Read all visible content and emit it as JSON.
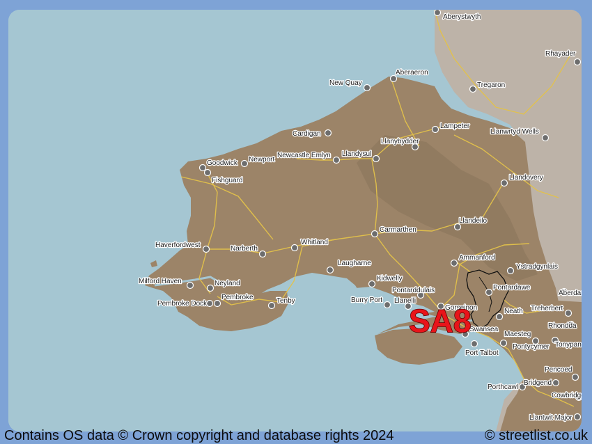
{
  "map": {
    "area_code": "SA8",
    "colors": {
      "sea": "#a5c6d2",
      "land": "#9c8468",
      "roads": "#e3c24a",
      "frame": "#7ea3d6",
      "area_label": "#e8141a"
    },
    "places": [
      {
        "name": "Aberystwyth"
      },
      {
        "name": "Rhayader"
      },
      {
        "name": "Aberaeron"
      },
      {
        "name": "New Quay"
      },
      {
        "name": "Tregaron"
      },
      {
        "name": "Cardigan"
      },
      {
        "name": "Lampeter"
      },
      {
        "name": "Llanwrtyd Wells"
      },
      {
        "name": "Llanybydder"
      },
      {
        "name": "Goodwick"
      },
      {
        "name": "Newport"
      },
      {
        "name": "Newcastle Emlyn"
      },
      {
        "name": "Llandysul"
      },
      {
        "name": "Fishguard"
      },
      {
        "name": "Llandovery"
      },
      {
        "name": "Carmarthen"
      },
      {
        "name": "Llandeilo"
      },
      {
        "name": "Haverfordwest"
      },
      {
        "name": "Narberth"
      },
      {
        "name": "Whitland"
      },
      {
        "name": "Ammanford"
      },
      {
        "name": "Laugharne"
      },
      {
        "name": "Ystradgynlais"
      },
      {
        "name": "Milford Haven"
      },
      {
        "name": "Neyland"
      },
      {
        "name": "Kidwelly"
      },
      {
        "name": "Pontardawe"
      },
      {
        "name": "Pontarddulais"
      },
      {
        "name": "Aberdare"
      },
      {
        "name": "Pembroke Dock"
      },
      {
        "name": "Pembroke"
      },
      {
        "name": "Tenby"
      },
      {
        "name": "Burry Port"
      },
      {
        "name": "Llanelli"
      },
      {
        "name": "Gorseinon"
      },
      {
        "name": "Neath"
      },
      {
        "name": "Treherbert"
      },
      {
        "name": "Swansea"
      },
      {
        "name": "Maesteg"
      },
      {
        "name": "Rhondda"
      },
      {
        "name": "Pontycymer"
      },
      {
        "name": "Tonypandy"
      },
      {
        "name": "Port Talbot"
      },
      {
        "name": "Pencoed"
      },
      {
        "name": "Bridgend"
      },
      {
        "name": "Porthcawl"
      },
      {
        "name": "Cowbridge"
      },
      {
        "name": "Llantwit Major"
      }
    ]
  },
  "footer": {
    "credit": "Contains OS data © Crown copyright and database rights 2024",
    "site": "© streetlist.co.uk"
  }
}
